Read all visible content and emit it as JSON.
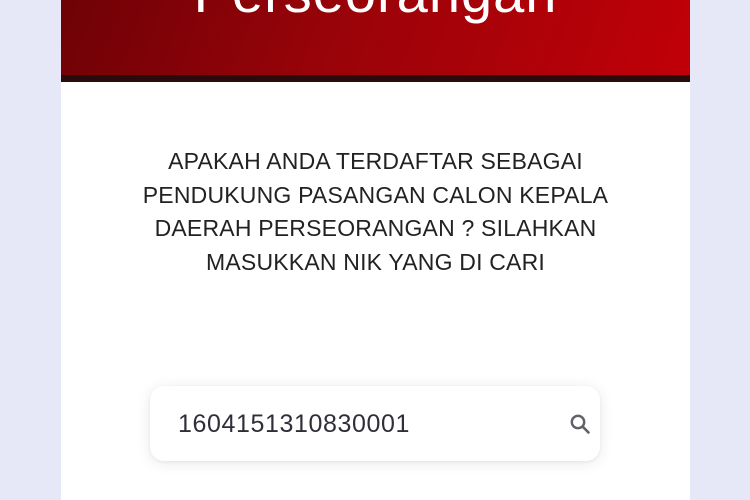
{
  "header": {
    "title": "Perseorangan"
  },
  "main": {
    "prompt": "APAKAH ANDA TERDAFTAR SEBAGAI PENDUKUNG PASANGAN CALON KEPALA DAERAH PERSEORANGAN ? SILAHKAN MASUKKAN NIK YANG DI CARI"
  },
  "search": {
    "value": "1604151310830001",
    "icon": "search-icon"
  },
  "colors": {
    "header_dark": "#6e0206",
    "header_light": "#c10008",
    "background": "#e6e8f7",
    "card": "#ffffff"
  }
}
